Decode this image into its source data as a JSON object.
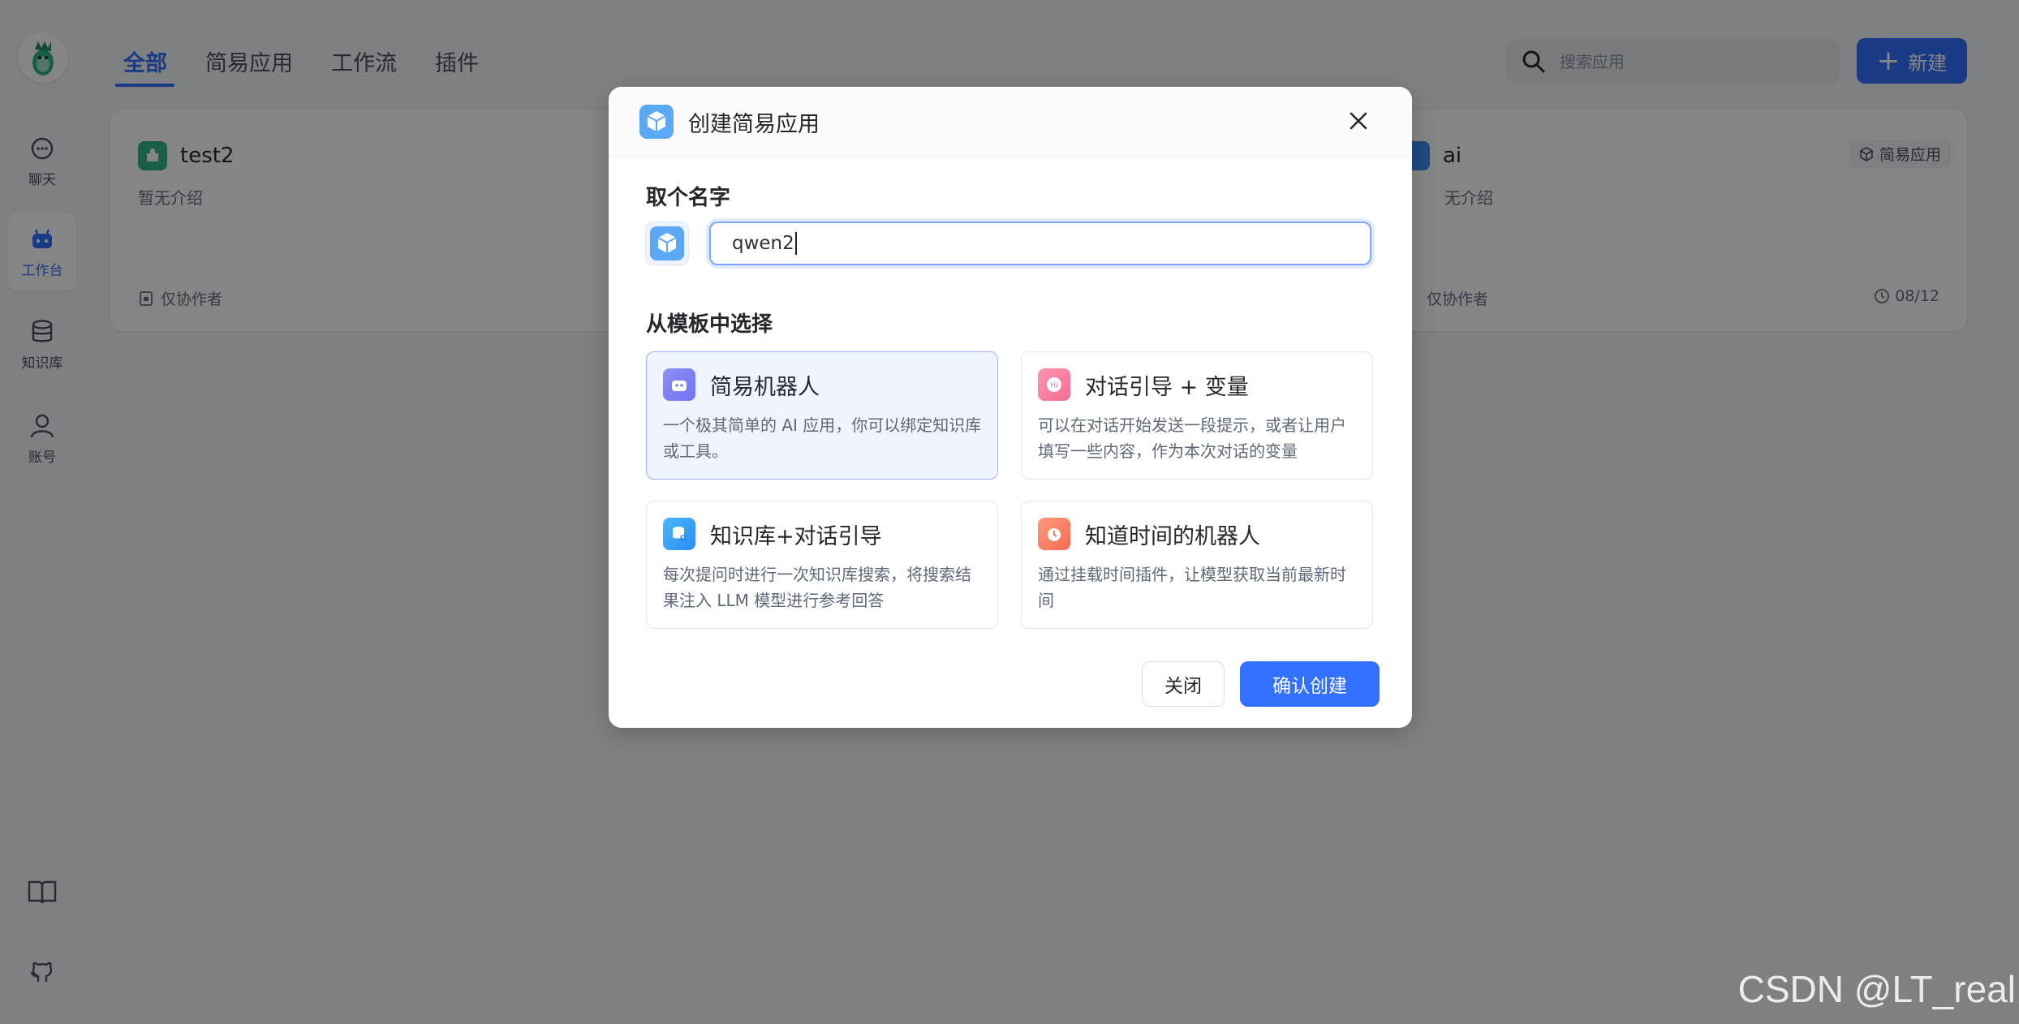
{
  "nav": {
    "items": [
      {
        "label": "聊天",
        "icon": "chat-icon"
      },
      {
        "label": "工作台",
        "icon": "robot-icon"
      },
      {
        "label": "知识库",
        "icon": "database-icon"
      },
      {
        "label": "账号",
        "icon": "user-icon"
      }
    ],
    "bottom_icons": [
      "book-icon",
      "github-icon"
    ]
  },
  "tabs": [
    "全部",
    "简易应用",
    "工作流",
    "插件"
  ],
  "search": {
    "placeholder": "搜索应用"
  },
  "new_button": "新建",
  "cards": [
    {
      "title": "test2",
      "desc": "暂无介绍",
      "permission": "仅协作者"
    },
    {
      "title": "ai",
      "desc": "无介绍",
      "permission": "仅协作者",
      "type": "简易应用",
      "date": "08/12"
    }
  ],
  "modal": {
    "title": "创建简易应用",
    "name_label": "取个名字",
    "name_value": "qwen2",
    "template_label": "从模板中选择",
    "templates": [
      {
        "title": "简易机器人",
        "desc": "一个极其简单的 AI 应用，你可以绑定知识库或工具。",
        "selected": true
      },
      {
        "title": "对话引导 + 变量",
        "desc": "可以在对话开始发送一段提示，或者让用户填写一些内容，作为本次对话的变量",
        "selected": false
      },
      {
        "title": "知识库+对话引导",
        "desc": "每次提问时进行一次知识库搜索，将搜索结果注入 LLM 模型进行参考回答",
        "selected": false
      },
      {
        "title": "知道时间的机器人",
        "desc": "通过挂载时间插件，让模型获取当前最新时间",
        "selected": false
      }
    ],
    "close_button": "关闭",
    "confirm_button": "确认创建"
  },
  "watermark": "CSDN @LT_real",
  "colors": {
    "primary": "#3370ff",
    "overlay": "rgba(0,0,0,0.48)"
  }
}
